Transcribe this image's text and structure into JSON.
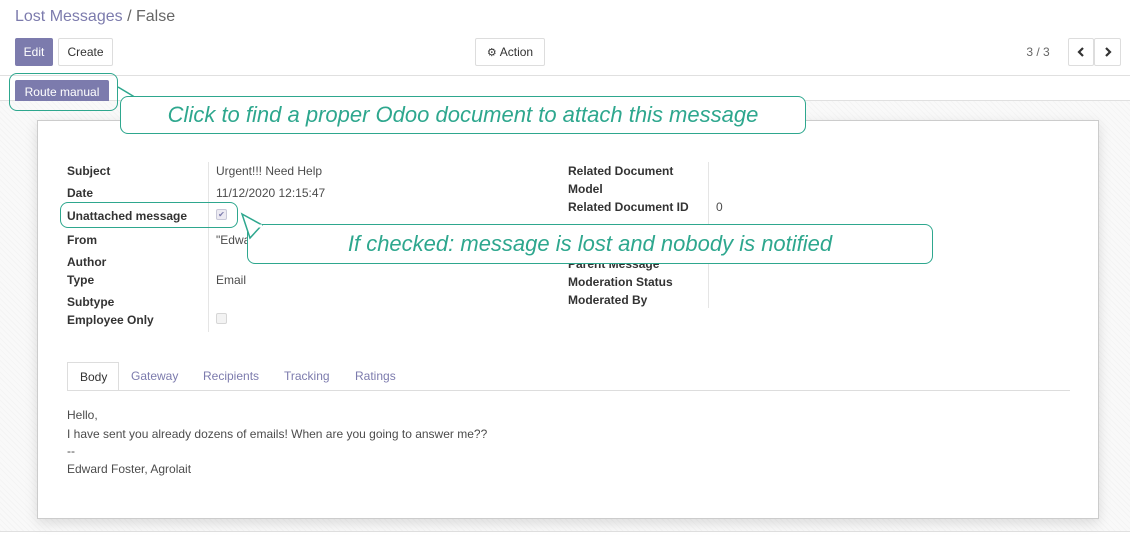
{
  "breadcrumb": {
    "parent": "Lost Messages",
    "separator": "/",
    "current": "False"
  },
  "toolbar": {
    "edit_label": "Edit",
    "create_label": "Create",
    "action_label": "Action",
    "action_icon": "gear-icon"
  },
  "pager": {
    "value": "3 / 3",
    "prev_icon": "chevron-left-icon",
    "next_icon": "chevron-right-icon"
  },
  "statusbar": {
    "route_label": "Route manual"
  },
  "form": {
    "left": [
      {
        "label": "Subject",
        "value": "Urgent!!! Need Help"
      },
      {
        "label": "Date",
        "value": "11/12/2020 12:15:47"
      },
      {
        "label": "Unattached message",
        "checked": true
      },
      {
        "label": "From",
        "value": "\"Edwa"
      },
      {
        "label": "Author",
        "value": ""
      },
      {
        "label": "Type",
        "value": "Email"
      },
      {
        "label": "Subtype",
        "value": ""
      },
      {
        "label": "Employee Only",
        "checked": false
      }
    ],
    "right": {
      "related_document_model_line1": "Related Document",
      "related_document_model_line2": "Model",
      "related_document_id_label": "Related Document ID",
      "related_document_id_value": "0",
      "parent_message_label": "Parent Message",
      "moderation_status_label": "Moderation Status",
      "moderated_by_label": "Moderated By"
    }
  },
  "tabs": [
    "Body",
    "Gateway",
    "Recipients",
    "Tracking",
    "Ratings"
  ],
  "body_lines": [
    "Hello,",
    "I have sent you already dozens of emails! When are you going to answer me??",
    "--",
    "Edward Foster, Agrolait"
  ],
  "callouts": {
    "route": "Click to find a proper Odoo document to attach this message",
    "unattached": "If checked: message is lost and nobody is notified"
  },
  "colors": {
    "accent": "#7c7bad",
    "callout": "#2ea78e"
  }
}
